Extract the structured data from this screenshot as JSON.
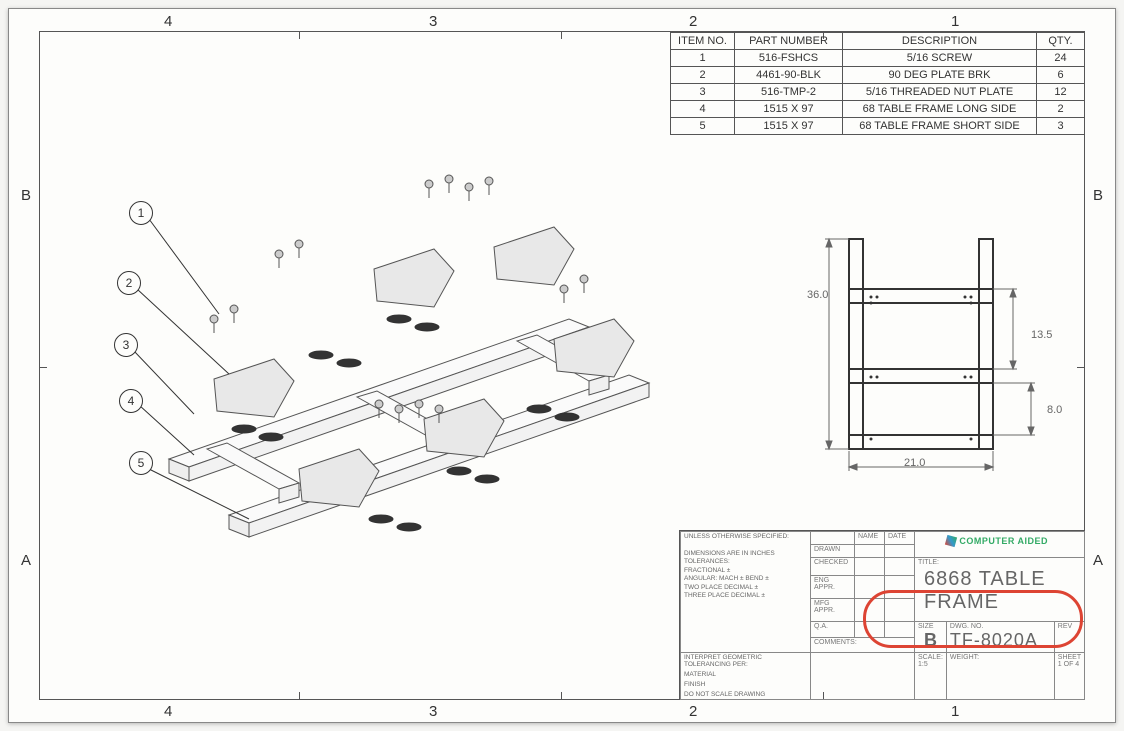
{
  "zones": {
    "cols": [
      "4",
      "3",
      "2",
      "1"
    ],
    "rows": [
      "B",
      "A"
    ]
  },
  "bom": {
    "headers": {
      "item": "ITEM NO.",
      "part": "PART NUMBER",
      "desc": "DESCRIPTION",
      "qty": "QTY."
    },
    "rows": [
      {
        "item": "1",
        "part": "516-FSHCS",
        "desc": "5/16 SCREW",
        "qty": "24"
      },
      {
        "item": "2",
        "part": "4461-90-BLK",
        "desc": "90 DEG PLATE BRK",
        "qty": "6"
      },
      {
        "item": "3",
        "part": "516-TMP-2",
        "desc": "5/16 THREADED NUT PLATE",
        "qty": "12"
      },
      {
        "item": "4",
        "part": "1515 X 97",
        "desc": "68 TABLE FRAME LONG SIDE",
        "qty": "2"
      },
      {
        "item": "5",
        "part": "1515 X 97",
        "desc": "68 TABLE FRAME SHORT SIDE",
        "qty": "3"
      }
    ]
  },
  "balloons": [
    "1",
    "2",
    "3",
    "4",
    "5"
  ],
  "right_view": {
    "dim_v1": "36.0",
    "dim_h_inner": "13.5",
    "dim_h_inner2": "8.0",
    "dim_w": "21.0"
  },
  "titleblock": {
    "notes_l1": "UNLESS OTHERWISE SPECIFIED:",
    "notes_l2": "DIMENSIONS ARE IN INCHES",
    "notes_l3": "TOLERANCES:",
    "notes_l4": "FRACTIONAL ±",
    "notes_l5": "ANGULAR: MACH ±  BEND ±",
    "notes_l6": "TWO PLACE DECIMAL   ±",
    "notes_l7": "THREE PLACE DECIMAL ±",
    "interp": "INTERPRET GEOMETRIC",
    "tol_per": "TOLERANCING PER:",
    "material": "MATERIAL",
    "finish": "FINISH",
    "dns": "DO NOT SCALE DRAWING",
    "name_h": "NAME",
    "date_h": "DATE",
    "rows": [
      "DRAWN",
      "CHECKED",
      "ENG APPR.",
      "MFG APPR.",
      "Q.A.",
      "COMMENTS:"
    ],
    "title_label": "TITLE:",
    "title": "6868 TABLE FRAME",
    "size_label": "SIZE",
    "size": "B",
    "dwgno_label": "DWG.  NO.",
    "dwgno": "TF-8020A",
    "rev_label": "REV",
    "scale_label": "SCALE: 1:5",
    "weight_label": "WEIGHT:",
    "sheet": "SHEET 1 OF 4",
    "logo": "COMPUTER AIDED"
  }
}
